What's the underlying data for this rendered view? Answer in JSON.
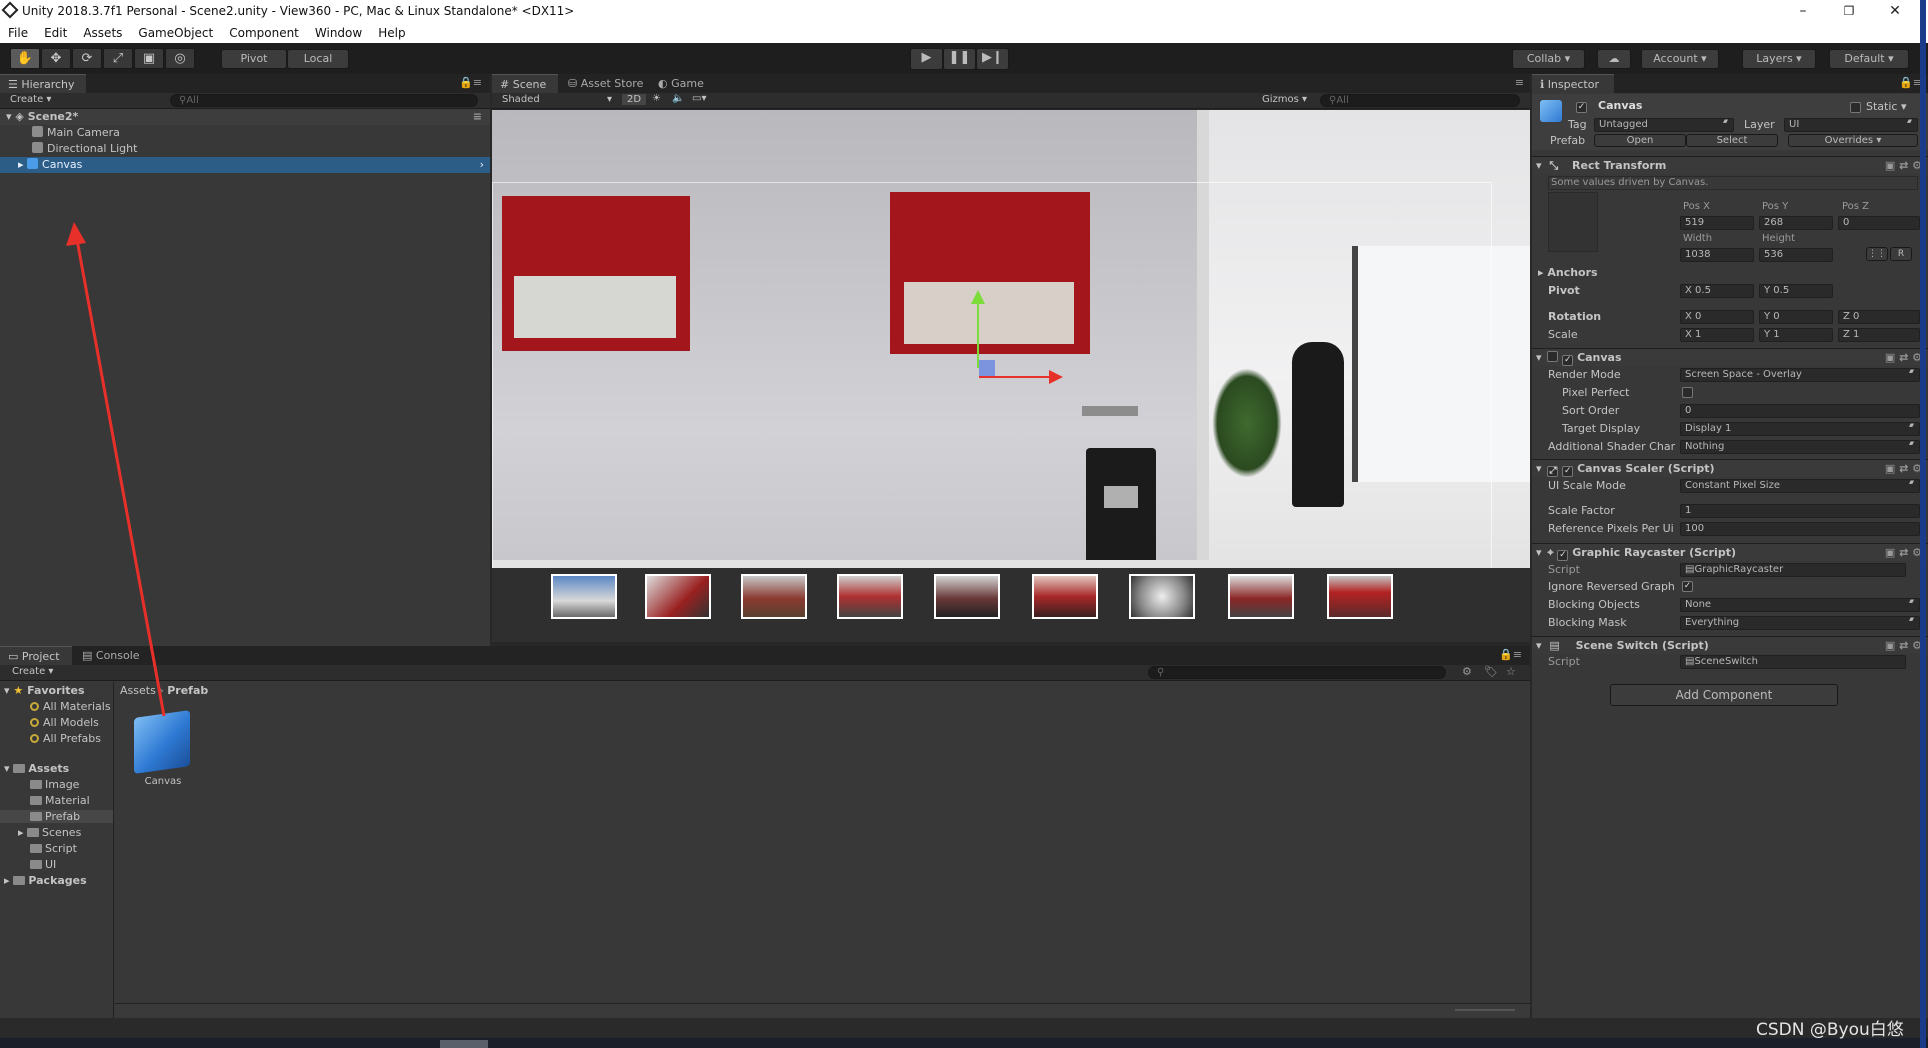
{
  "window": {
    "title": "Unity 2018.3.7f1 Personal - Scene2.unity - View360 - PC, Mac & Linux Standalone* <DX11>",
    "minimize": "–",
    "maximize": "❐",
    "close": "✕"
  },
  "menu": [
    "File",
    "Edit",
    "Assets",
    "GameObject",
    "Component",
    "Window",
    "Help"
  ],
  "toolbar": {
    "pivot": "Pivot",
    "local": "Local",
    "collab": "Collab",
    "account": "Account",
    "layers": "Layers",
    "layout": "Default"
  },
  "hierarchy": {
    "tab": "Hierarchy",
    "create": "Create",
    "search_placeholder": "All",
    "scene": "Scene2*",
    "items": [
      "Main Camera",
      "Directional Light",
      "Canvas"
    ]
  },
  "scene_view": {
    "tabs": [
      "Scene",
      "Asset Store",
      "Game"
    ],
    "shading": "Shaded",
    "mode_2d": "2D",
    "gizmos": "Gizmos",
    "search_placeholder": "All"
  },
  "project": {
    "tabs": [
      "Project",
      "Console"
    ],
    "create": "Create",
    "favorites_label": "Favorites",
    "favorites": [
      "All Materials",
      "All Models",
      "All Prefabs"
    ],
    "assets_label": "Assets",
    "assets": [
      "Image",
      "Material",
      "Prefab",
      "Scenes",
      "Script",
      "UI"
    ],
    "packages_label": "Packages",
    "breadcrumb": [
      "Assets",
      "Prefab"
    ],
    "grid_items": [
      {
        "name": "Canvas"
      }
    ]
  },
  "inspector": {
    "tab": "Inspector",
    "object_name": "Canvas",
    "static_label": "Static",
    "tag_label": "Tag",
    "tag": "Untagged",
    "layer_label": "Layer",
    "layer": "UI",
    "prefab_label": "Prefab",
    "prefab_open": "Open",
    "prefab_select": "Select",
    "prefab_overrides": "Overrides",
    "rect_transform": {
      "title": "Rect Transform",
      "note": "Some values driven by Canvas.",
      "pos_x_label": "Pos X",
      "pos_y_label": "Pos Y",
      "pos_z_label": "Pos Z",
      "pos_x": "519",
      "pos_y": "268",
      "pos_z": "0",
      "width_label": "Width",
      "height_label": "Height",
      "width": "1038",
      "height": "536",
      "anchors": "Anchors",
      "pivot_label": "Pivot",
      "pivot_x": "X 0.5",
      "pivot_y": "Y 0.5",
      "rotation_label": "Rotation",
      "rot_x": "X 0",
      "rot_y": "Y 0",
      "rot_z": "Z 0",
      "scale_label": "Scale",
      "scale_x": "X 1",
      "scale_y": "Y 1",
      "scale_z": "Z 1",
      "r_button": "R"
    },
    "canvas": {
      "title": "Canvas",
      "render_mode_label": "Render Mode",
      "render_mode": "Screen Space - Overlay",
      "pixel_perfect_label": "Pixel Perfect",
      "sort_order_label": "Sort Order",
      "sort_order": "0",
      "target_display_label": "Target Display",
      "target_display": "Display 1",
      "shader_label": "Additional Shader Char",
      "shader": "Nothing"
    },
    "scaler": {
      "title": "Canvas Scaler (Script)",
      "mode_label": "UI Scale Mode",
      "mode": "Constant Pixel Size",
      "scale_factor_label": "Scale Factor",
      "scale_factor": "1",
      "ref_label": "Reference Pixels Per Ui",
      "ref": "100"
    },
    "raycaster": {
      "title": "Graphic Raycaster (Script)",
      "script_label": "Script",
      "script": "GraphicRaycaster",
      "ignore_label": "Ignore Reversed Graph",
      "blocking_objects_label": "Blocking Objects",
      "blocking_objects": "None",
      "blocking_mask_label": "Blocking Mask",
      "blocking_mask": "Everything"
    },
    "scene_switch": {
      "title": "Scene Switch (Script)",
      "script_label": "Script",
      "script": "SceneSwitch"
    },
    "add_component": "Add Component"
  },
  "watermark": "CSDN @Byou白悠",
  "colors": {
    "selection": "#2c5d87",
    "panel": "#383838",
    "arrow": "#e8302a"
  },
  "icons": [
    "hand-icon",
    "move-icon",
    "rotate-icon",
    "scale-icon",
    "rect-icon",
    "transform-icon",
    "play-icon",
    "pause-icon",
    "step-icon",
    "cloud-icon"
  ]
}
